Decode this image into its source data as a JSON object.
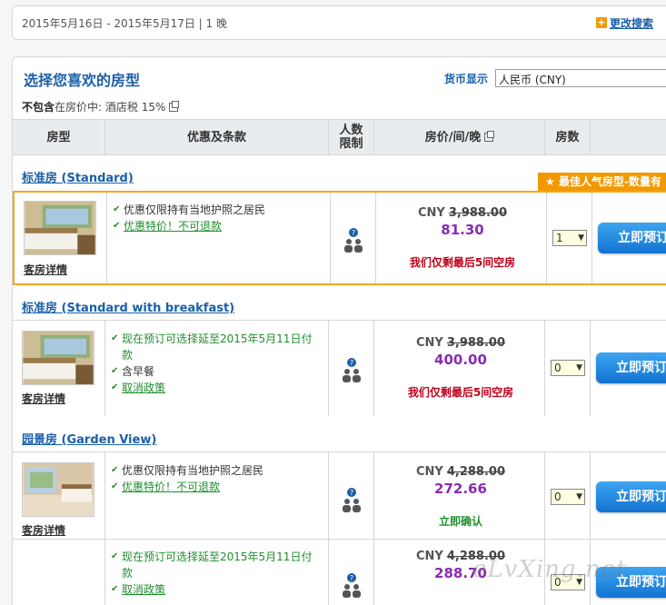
{
  "search": {
    "dates": "2015年5月16日 - 2015年5月17日 | 1 晚",
    "change_label": "更改搜索",
    "plus_icon": "+"
  },
  "panel": {
    "title": "选择您喜欢的房型",
    "currency_label": "货币显示",
    "currency_value": "人民币 (CNY)",
    "tax_bold": "不包含",
    "tax_rest": "在房价中: 酒店税 15%"
  },
  "table_headers": {
    "room_type": "房型",
    "offers": "优惠及条款",
    "guests_line1": "人数",
    "guests_line2": "限制",
    "price": "房价/间/晚",
    "rooms": "房数"
  },
  "popular_badge": "最佳人气房型-数量有",
  "rooms": [
    {
      "title": "标准房 (Standard)",
      "detail_link": "客房详情",
      "perks": [
        "优惠仅限持有当地护照之居民",
        "优惠特价！不可退款"
      ],
      "currency": "CNY",
      "original_price": "3,988.00",
      "price": "81.30",
      "note": "我们仅剩最后5间空房",
      "qty": "1",
      "book_label": "立即预订"
    },
    {
      "title": "标准房 (Standard with breakfast)",
      "detail_link": "客房详情",
      "perks": [
        "现在预订可选择延至2015年5月11日付款",
        "含早餐",
        "取消政策"
      ],
      "currency": "CNY",
      "original_price": "3,988.00",
      "price": "400.00",
      "note": "我们仅剩最后5间空房",
      "qty": "0",
      "book_label": "立即预订"
    },
    {
      "title": "园景房 (Garden View)",
      "detail_link": "客房详情",
      "perks": [
        "优惠仅限持有当地护照之居民",
        "优惠特价！不可退款"
      ],
      "currency": "CNY",
      "original_price": "4,288.00",
      "price": "272.66",
      "note": "立即确认",
      "qty": "0",
      "book_label": "立即预订"
    },
    {
      "perks": [
        "现在预订可选择延至2015年5月11日付款",
        "取消政策"
      ],
      "currency": "CNY",
      "original_price": "4,288.00",
      "price": "288.70",
      "qty": "0",
      "book_label": "立即预订"
    }
  ],
  "watermark": "eLvXing.net",
  "icons": {
    "plus": "plus-icon",
    "popout": "popout-icon",
    "guests": "guests-icon",
    "star": "star-icon",
    "check": "check-icon"
  },
  "colors": {
    "link_blue": "#1a5fa8",
    "accent_orange": "#f39800",
    "price_purple": "#8a2bb3",
    "alert_red": "#c0001a",
    "ok_green": "#1f8f2e",
    "button_blue": "#1273d1"
  }
}
